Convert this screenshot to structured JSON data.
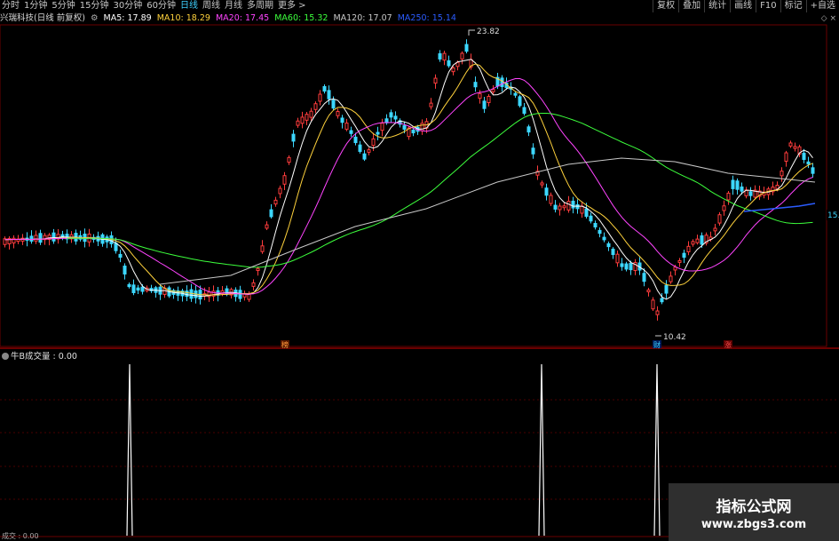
{
  "toolbar": {
    "tabs": [
      "分时",
      "1分钟",
      "5分钟",
      "15分钟",
      "30分钟",
      "60分钟",
      "日线",
      "周线",
      "月线",
      "多周期",
      "更多 >"
    ],
    "active_index": 6,
    "right_buttons": [
      "复权",
      "叠加",
      "统计",
      "画线",
      "F10",
      "标记",
      "+自选"
    ]
  },
  "legend": {
    "title": "兴瑞科技(日线 前复权)",
    "ma5": "MA5: 17.89",
    "ma10": "MA10: 18.29",
    "ma20": "MA20: 17.45",
    "ma60": "MA60: 15.32",
    "ma120": "MA120: 17.07",
    "ma250": "MA250: 15.14"
  },
  "annotations": {
    "high": "23.82",
    "low": "10.42",
    "price_tag": "15.",
    "marker_1": "榜",
    "marker_2": "财",
    "marker_3": "涨"
  },
  "indicator": {
    "label": "牛B成交量 : 0.00",
    "bottom_label": "成交 : 0.00"
  },
  "watermark": {
    "line1": "指标公式网",
    "line2": "www.zbgs3.com"
  },
  "colors": {
    "up": "#ff3c3c",
    "down": "#3cd7ff",
    "ma5": "#ffffff",
    "ma10": "#ffd23c",
    "ma20": "#ff44ff",
    "ma60": "#3cff3c",
    "ma120": "#c8c8c8",
    "ma250": "#2b5cff"
  }
}
